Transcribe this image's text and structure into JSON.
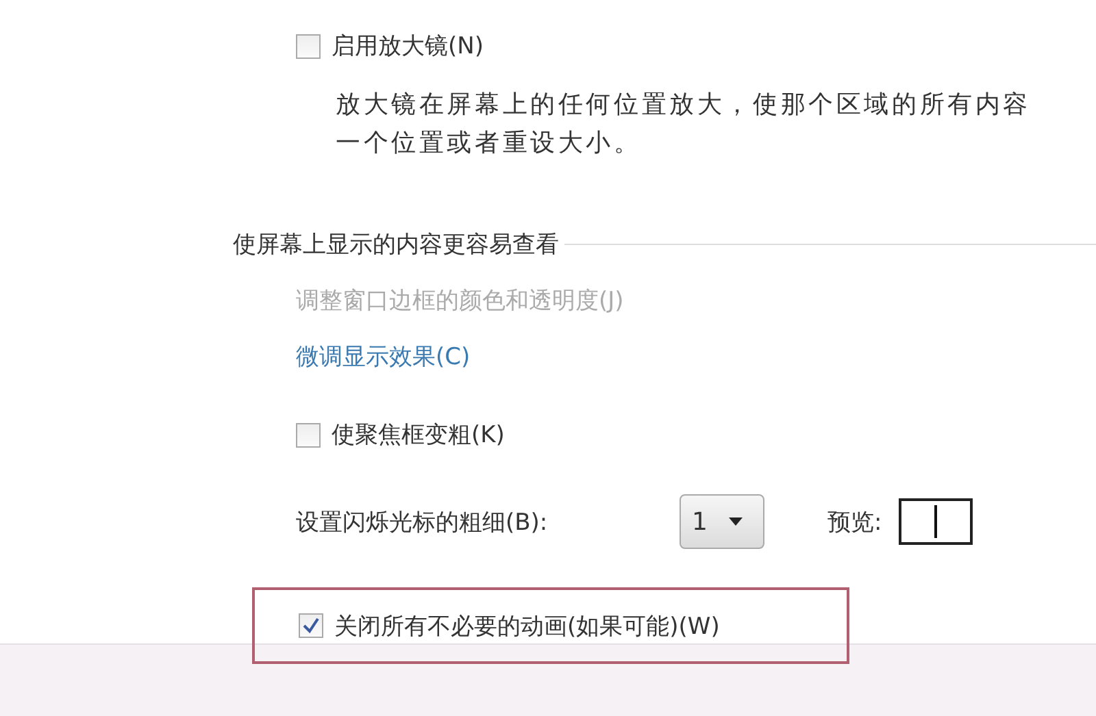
{
  "magnifier": {
    "checkbox": {
      "label": "启用放大镜(N)",
      "checked": false
    },
    "description": [
      "放大镜在屏幕上的任何位置放大，使那个区域的所有内容",
      "一个位置或者重设大小。"
    ]
  },
  "section": {
    "heading": "使屏幕上显示的内容更容易查看",
    "links": [
      {
        "label": "调整窗口边框的颜色和透明度(J)",
        "disabled": true
      },
      {
        "label": "微调显示效果(C)",
        "disabled": false
      }
    ],
    "focus_checkbox": {
      "label": "使聚焦框变粗(K)",
      "checked": false
    },
    "cursor": {
      "label": "设置闪烁光标的粗细(B):",
      "value": "1",
      "preview_label": "预览:"
    },
    "animation_checkbox": {
      "label": "关闭所有不必要的动画(如果可能)(W)",
      "checked": true,
      "highlighted": true
    }
  }
}
